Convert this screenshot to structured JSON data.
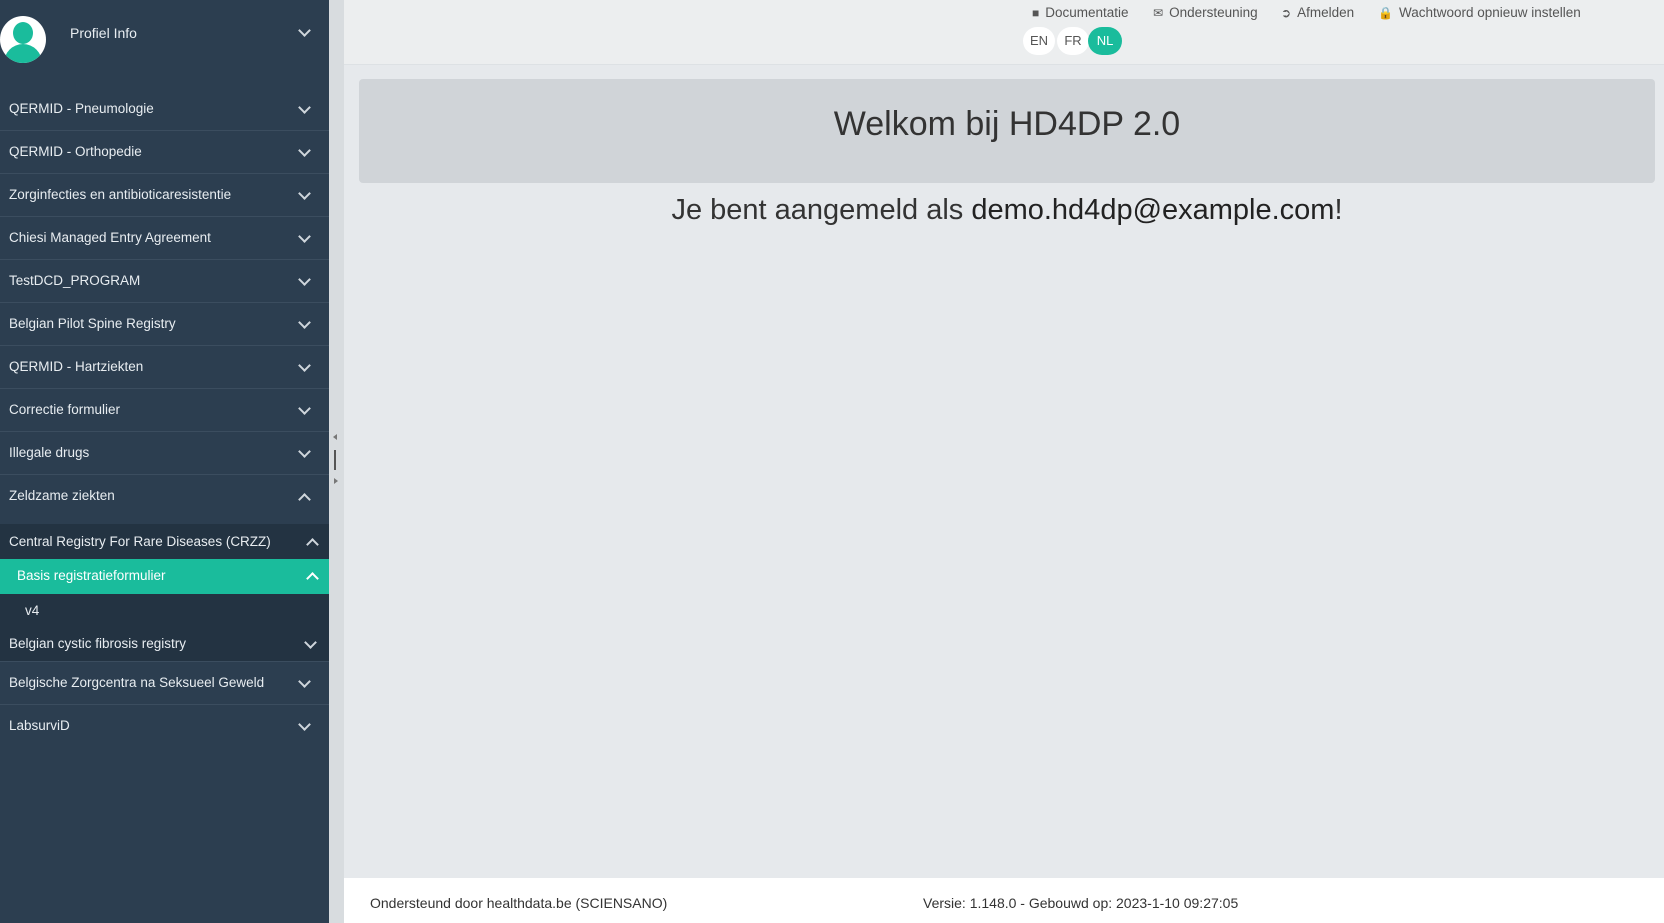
{
  "sidebar": {
    "profile_label": "Profiel Info",
    "items": [
      {
        "label": "QERMID - Pneumologie"
      },
      {
        "label": "QERMID - Orthopedie"
      },
      {
        "label": "Zorginfecties en antibioticaresistentie"
      },
      {
        "label": "Chiesi Managed Entry Agreement"
      },
      {
        "label": "TestDCD_PROGRAM"
      },
      {
        "label": "Belgian Pilot Spine Registry"
      },
      {
        "label": "QERMID - Hartziekten"
      },
      {
        "label": "Correctie formulier"
      },
      {
        "label": "Illegale drugs"
      },
      {
        "label": "Zeldzame ziekten"
      },
      {
        "label": "Belgische Zorgcentra na Seksueel Geweld"
      },
      {
        "label": "LabsurviD"
      }
    ],
    "sub": {
      "registry": "Central Registry For Rare Diseases (CRZZ)",
      "form": "Basis registratieformulier",
      "version": "v4",
      "other_registry": "Belgian cystic fibrosis registry"
    }
  },
  "topbar": {
    "links": {
      "documentation": "Documentatie",
      "support": "Ondersteuning",
      "logout": "Afmelden",
      "reset_password": "Wachtwoord opnieuw instellen"
    },
    "languages": {
      "en": "EN",
      "fr": "FR",
      "nl": "NL"
    },
    "active_language": "NL"
  },
  "main": {
    "title": "Welkom bij HD4DP 2.0",
    "welcome_prefix": "Je bent aangemeld als ",
    "user_email": "demo.hd4dp@example.com",
    "welcome_suffix": "!"
  },
  "footer": {
    "supported_by": "Ondersteund door healthdata.be (SCIENSANO)",
    "version_info": "Versie: 1.148.0  -  Gebouwd op: 2023-1-10 09:27:05"
  },
  "colors": {
    "sidebar_bg": "#2c3e50",
    "accent": "#1abc9c"
  }
}
